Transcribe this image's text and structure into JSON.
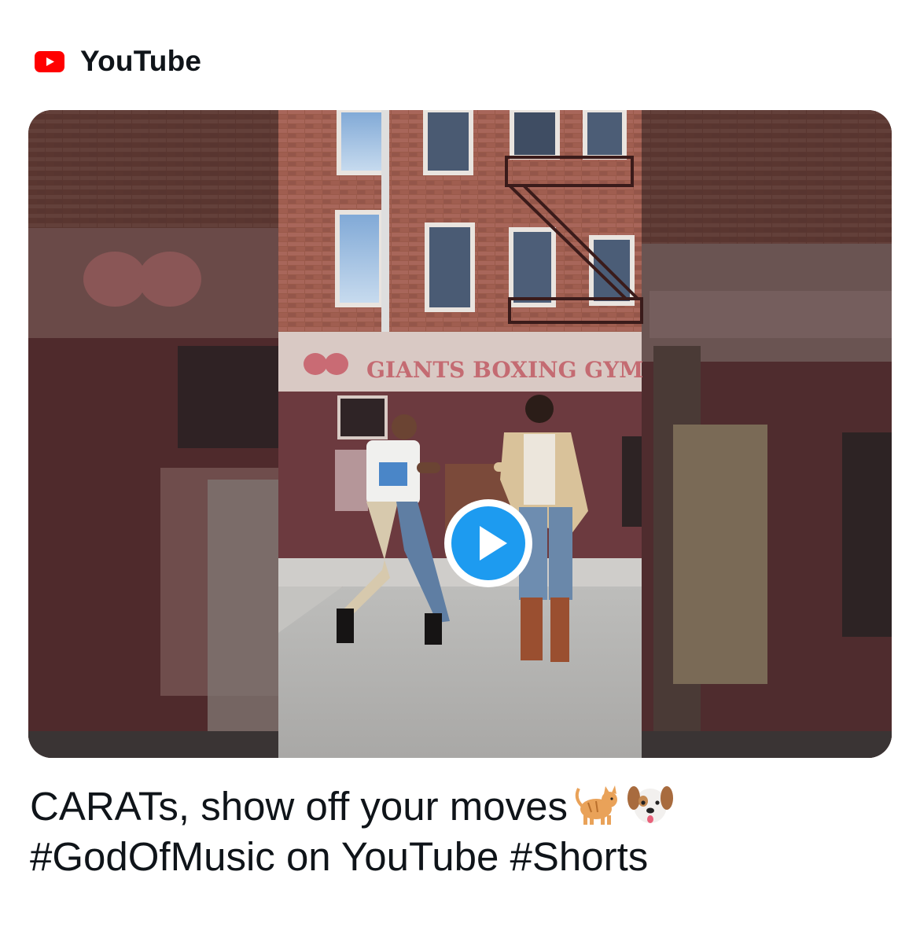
{
  "source": {
    "icon": "youtube-logo-icon",
    "name": "YouTube",
    "brand_color": "#ff0000"
  },
  "media": {
    "kind": "video-thumbnail",
    "play_icon": "play-icon",
    "accent_color": "#1d9bf0",
    "storefront_sign": "GIANTS BOXING GYM"
  },
  "caption": {
    "line1": "CARATs, show off your moves",
    "line1_emojis": [
      "cat-emoji-icon",
      "dog-face-emoji-icon"
    ],
    "line2": "#GodOfMusic on YouTube #Shorts"
  }
}
